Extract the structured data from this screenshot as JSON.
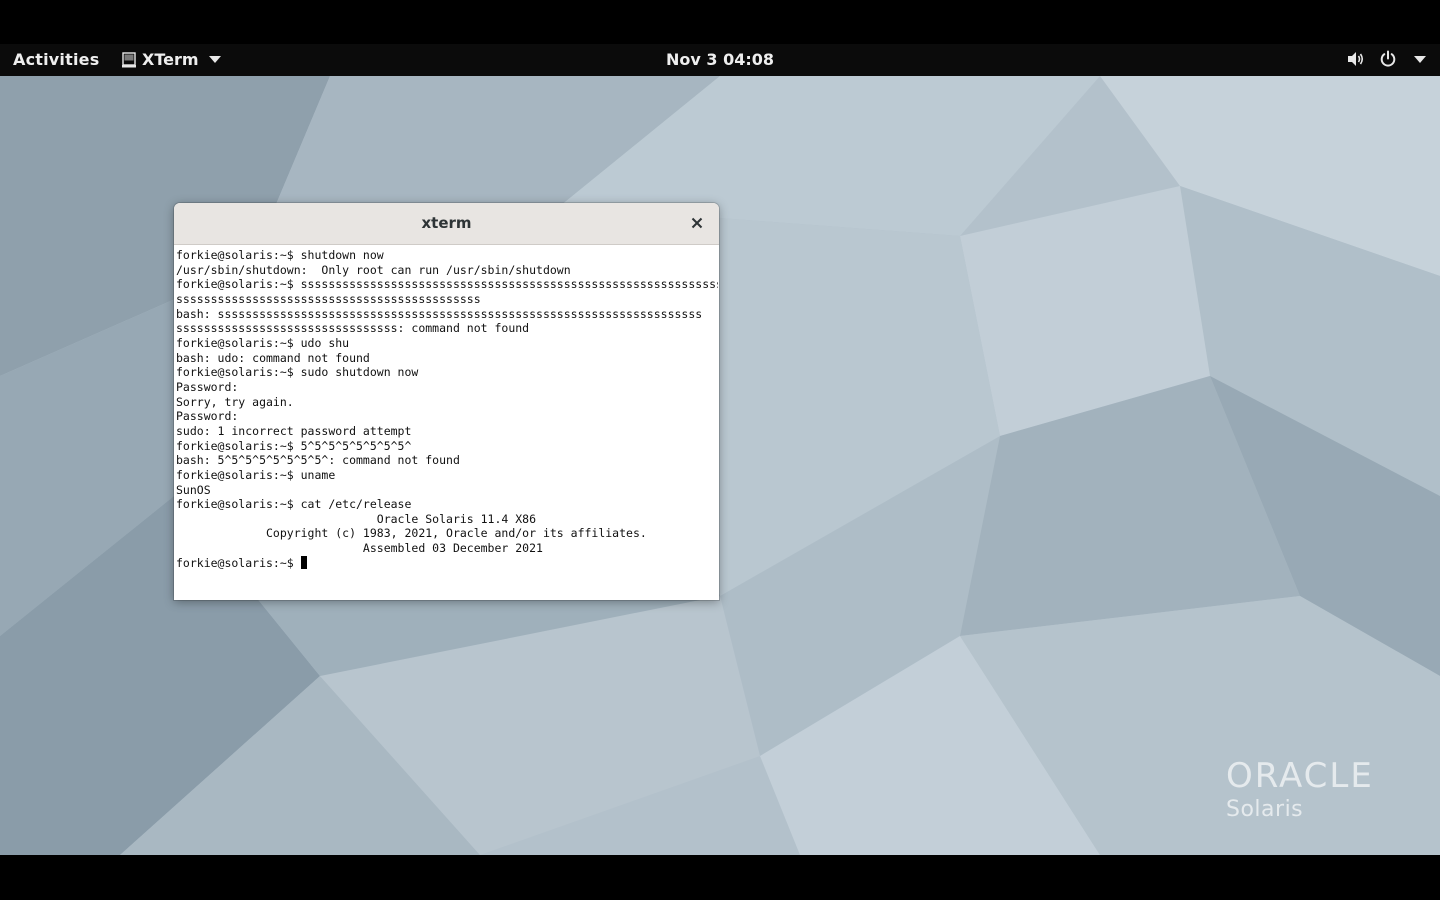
{
  "topbar": {
    "activities_label": "Activities",
    "app_name": "XTerm",
    "clock": "Nov 3  04:08",
    "status_icons": [
      "volume-icon",
      "power-icon",
      "chevron-down-icon"
    ]
  },
  "window": {
    "title": "xterm",
    "close_glyph": "×"
  },
  "terminal": {
    "lines": [
      "forkie@solaris:~$ shutdown now",
      "/usr/sbin/shutdown:  Only root can run /usr/sbin/shutdown",
      "forkie@solaris:~$ ssssssssssssssssssssssssssssssssssssssssssssssssssssssssssssssss",
      "ssssssssssssssssssssssssssssssssssssssssssss",
      "bash: ssssssssssssssssssssssssssssssssssssssssssssssssssssssssssssssssssssss",
      "ssssssssssssssssssssssssssssssss: command not found",
      "forkie@solaris:~$ udo shu",
      "bash: udo: command not found",
      "forkie@solaris:~$ sudo shutdown now",
      "Password:",
      "Sorry, try again.",
      "Password:",
      "sudo: 1 incorrect password attempt",
      "forkie@solaris:~$ 5^5^5^5^5^5^5^5^",
      "bash: 5^5^5^5^5^5^5^5^: command not found",
      "forkie@solaris:~$ uname",
      "SunOS",
      "forkie@solaris:~$ cat /etc/release",
      "                             Oracle Solaris 11.4 X86",
      "             Copyright (c) 1983, 2021, Oracle and/or its affiliates.",
      "                           Assembled 03 December 2021"
    ],
    "prompt": "forkie@solaris:~$ "
  },
  "desktop": {
    "logo_brand": "ORACLE",
    "logo_product": "Solaris"
  },
  "colors": {
    "topbar_bg": "#0b0b0b",
    "titlebar_bg": "#e8e5e2",
    "wallpaper_base": "#aebcc6"
  }
}
